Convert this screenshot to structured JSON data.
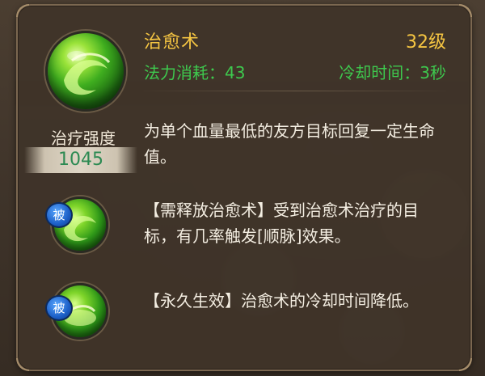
{
  "skill": {
    "name": "治愈术",
    "level": "32级",
    "mana_cost": "法力消耗：43",
    "cooldown": "冷却时间：3秒",
    "icon": "healing-skill-icon",
    "description": "为单个血量最低的友方目标回复一定生命值。"
  },
  "stats": {
    "strength_label": "治疗强度",
    "strength_value": "1045"
  },
  "passives": [
    {
      "badge": "被",
      "icon": "passive-healing-icon",
      "description": "【需释放治愈术】受到治愈术治疗的目标，有几率触发[顺脉]效果。"
    },
    {
      "badge": "被",
      "icon": "passive-cooldown-icon",
      "description": "【永久生效】治愈术的冷却时间降低。"
    }
  ],
  "colors": {
    "title": "#f5c542",
    "stat_green": "#3ec94e",
    "strength_value": "#2c8a52",
    "text": "#f4eee2",
    "panel_bg": "#3f3429",
    "panel_border": "#7b6750"
  }
}
